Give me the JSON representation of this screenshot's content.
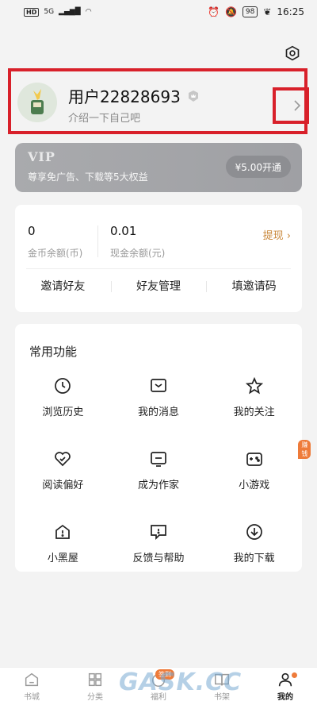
{
  "status_bar": {
    "network": "HD",
    "signal": "5G",
    "battery": "98",
    "time": "16:25"
  },
  "profile": {
    "username": "用户22828693",
    "intro": "介绍一下自己吧"
  },
  "vip": {
    "title": "VIP",
    "subtitle": "尊享免广告、下载等5大权益",
    "button": "¥5.00开通"
  },
  "wallet": {
    "coins_value": "0",
    "coins_label": "金币余额(币)",
    "cash_value": "0.01",
    "cash_label": "现金余额(元)",
    "withdraw": "提现",
    "links": [
      "邀请好友",
      "好友管理",
      "填邀请码"
    ]
  },
  "features": {
    "title": "常用功能",
    "items": [
      {
        "label": "浏览历史",
        "icon": "clock-icon"
      },
      {
        "label": "我的消息",
        "icon": "message-icon"
      },
      {
        "label": "我的关注",
        "icon": "star-icon"
      },
      {
        "label": "阅读偏好",
        "icon": "heart-icon"
      },
      {
        "label": "成为作家",
        "icon": "write-icon"
      },
      {
        "label": "小游戏",
        "icon": "gamepad-icon",
        "badge": "赚钱"
      },
      {
        "label": "小黑屋",
        "icon": "house-icon"
      },
      {
        "label": "反馈与帮助",
        "icon": "feedback-icon"
      },
      {
        "label": "我的下载",
        "icon": "download-icon"
      }
    ]
  },
  "tabbar": {
    "tabs": [
      {
        "label": "书城",
        "icon": "home-icon"
      },
      {
        "label": "分类",
        "icon": "category-icon"
      },
      {
        "label": "福利",
        "icon": "gift-icon",
        "badge": "签到"
      },
      {
        "label": "书架",
        "icon": "book-icon"
      },
      {
        "label": "我的",
        "icon": "person-icon",
        "active": true
      }
    ]
  },
  "watermark": "GASK.CC",
  "colors": {
    "highlight_border": "#d8202a",
    "accent": "#ee7b3a",
    "withdraw": "#c9873a",
    "vip_bg": "#a4a5a8"
  }
}
